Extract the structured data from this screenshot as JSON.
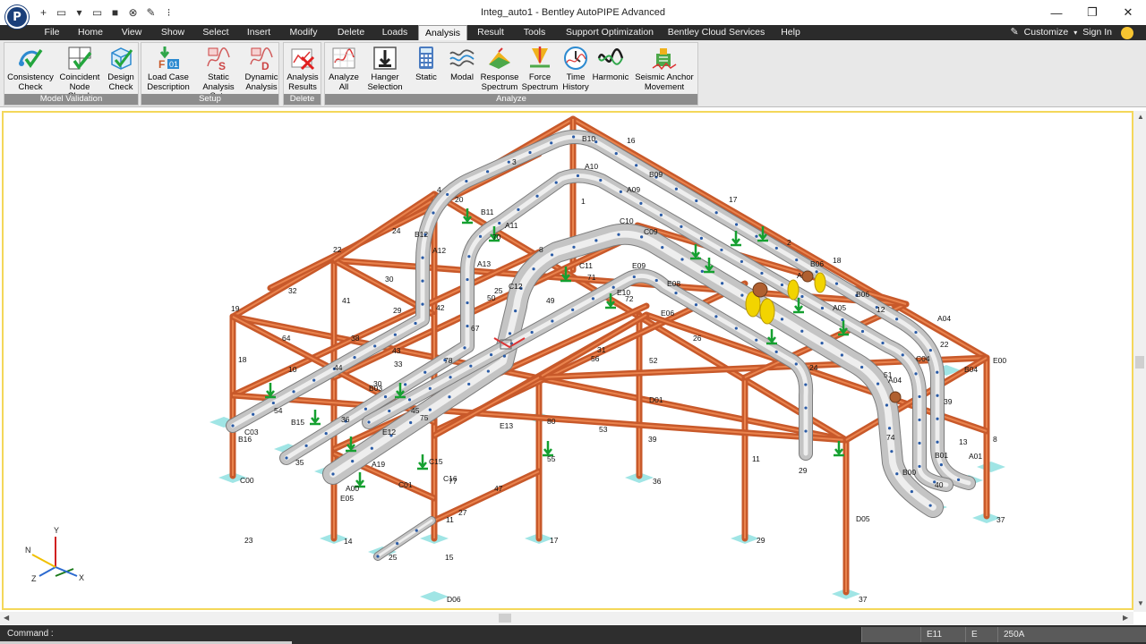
{
  "window": {
    "title": "Integ_auto1 - Bentley AutoPIPE Advanced",
    "logo": "P"
  },
  "quick_access": [
    {
      "name": "new-icon",
      "glyph": "+"
    },
    {
      "name": "open-folder-icon",
      "glyph": "▭"
    },
    {
      "name": "dropdown-chevron-icon",
      "glyph": "▾"
    },
    {
      "name": "open-model-icon",
      "glyph": "▭"
    },
    {
      "name": "save-icon",
      "glyph": "■"
    },
    {
      "name": "close-model-icon",
      "glyph": "⊗"
    },
    {
      "name": "edit-icon",
      "glyph": "✎"
    },
    {
      "name": "customize-qat-icon",
      "glyph": "⁝"
    }
  ],
  "menu": {
    "tabs": [
      "File",
      "Home",
      "View",
      "Show",
      "Select",
      "Insert",
      "Modify",
      "Delete",
      "Loads",
      "Analysis",
      "Result",
      "Tools",
      "Support Optimization",
      "Bentley Cloud Services",
      "Help"
    ],
    "active_tab": "Analysis",
    "customize": "Customize",
    "sign_in": "Sign In"
  },
  "ribbon": {
    "groups": [
      {
        "label": "Model Validation",
        "buttons": [
          "Consistency\nCheck",
          "Coincident\nNode Check",
          "Design\nCheck"
        ]
      },
      {
        "label": "Setup",
        "buttons": [
          "Load Case\nDescription",
          "Static\nAnalysis Sets",
          "Dynamic\nAnalysis"
        ]
      },
      {
        "label": "Delete",
        "buttons": [
          "Analysis\nResults"
        ]
      },
      {
        "label": "Analyze",
        "buttons": [
          "Analyze\nAll",
          "Hanger\nSelection",
          "Static",
          "Modal",
          "Response\nSpectrum",
          "Force\nSpectrum",
          "Time\nHistory",
          "Harmonic",
          "Seismic Anchor\nMovement"
        ]
      }
    ]
  },
  "model": {
    "labels": [
      "B10",
      "16",
      "3",
      "A10",
      "B09",
      "A09",
      "17",
      "4",
      "20",
      "1",
      "C10",
      "B11",
      "A11",
      "24",
      "B12",
      "70",
      "A12",
      "C09",
      "22",
      "A13",
      "8",
      "2",
      "C11",
      "71",
      "E09",
      "B06",
      "A06",
      "18",
      "32",
      "41",
      "30",
      "25",
      "50",
      "C12",
      "E10",
      "72",
      "E08",
      "A05",
      "49",
      "12",
      "B06",
      "A04",
      "19",
      "29",
      "42",
      "24",
      "E06",
      "64",
      "38",
      "67",
      "31",
      "26",
      "22",
      "B04",
      "E00",
      "18",
      "43",
      "33",
      "78",
      "56",
      "52",
      "51",
      "C04",
      "A04",
      "10",
      "44",
      "30",
      "D01",
      "39",
      "B03",
      "36",
      "45",
      "E12",
      "E13",
      "80",
      "53",
      "54",
      "B15",
      "75",
      "74",
      "C03",
      "B16",
      "35",
      "A19",
      "C15",
      "39",
      "8",
      "11",
      "13",
      "B01",
      "A01",
      "B00",
      "A00",
      "C01",
      "C16",
      "77",
      "47",
      "23",
      "55",
      "29",
      "40",
      "E05",
      "C00",
      "36",
      "27",
      "11",
      "D05",
      "37",
      "14",
      "17",
      "29",
      "25",
      "15",
      "D06",
      "37",
      "31",
      "19"
    ],
    "axis": {
      "x": "X",
      "y": "Y",
      "z": "Z",
      "n": "N"
    }
  },
  "statusbar": {
    "command_label": "Command :",
    "command_value": "",
    "cells": [
      "",
      "E11",
      "E",
      "250A"
    ]
  },
  "colors": {
    "steel": "#c8592a",
    "pipe": "#c4c4c4",
    "node": "#2a5ba6",
    "support": "#15a030",
    "anchor": "#8fe0e0",
    "selection_border": "#f4d75a"
  }
}
